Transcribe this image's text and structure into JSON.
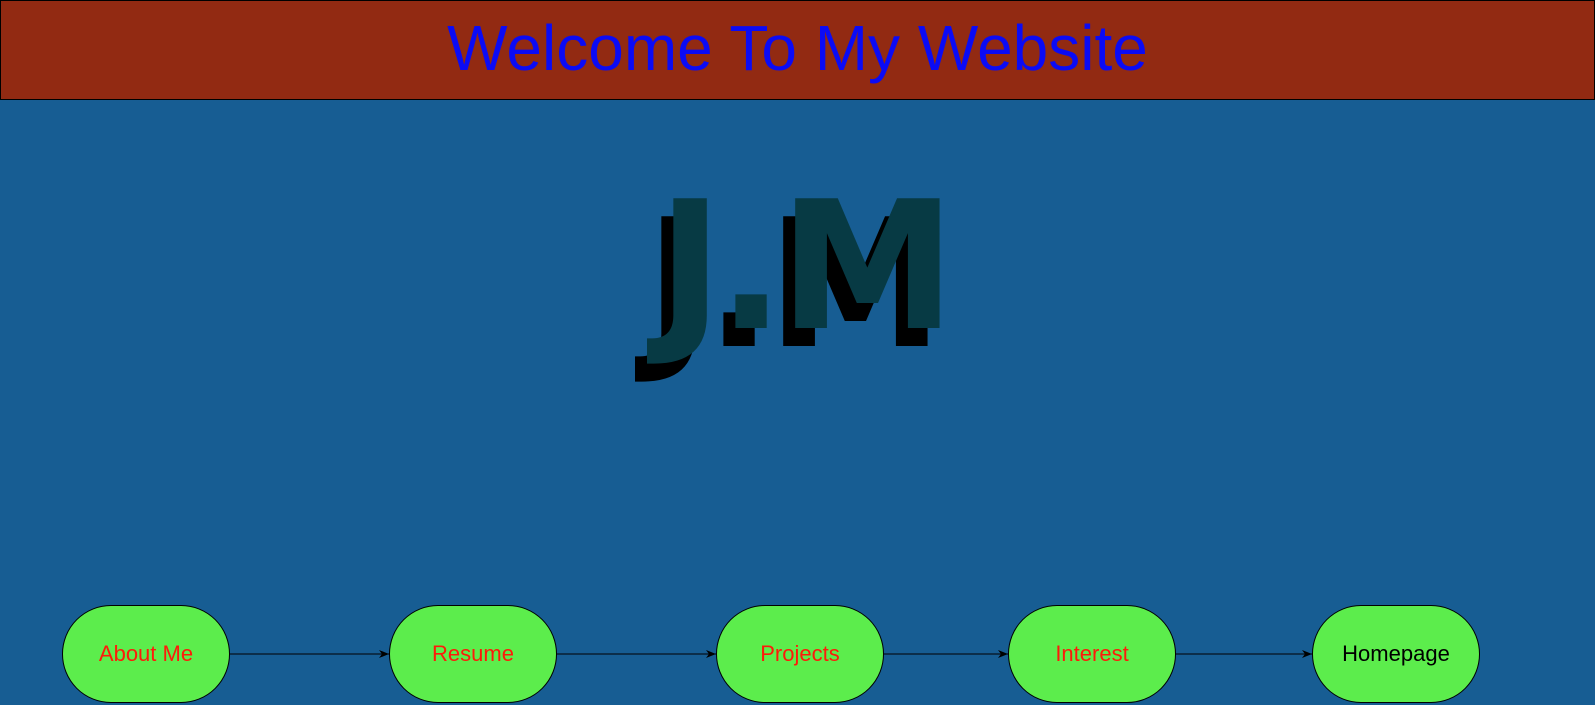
{
  "header": {
    "title": "Welcome To My Website",
    "background": "#922a12",
    "title_color": "#0b0bf5"
  },
  "monogram": {
    "text": "J.M",
    "front_color": "#073a44",
    "shadow_color": "#000000"
  },
  "page_background": "#175d93",
  "flow": {
    "node_fill": "#5ced4c",
    "nodes": [
      {
        "label": "About Me",
        "color": "#ff1a0a"
      },
      {
        "label": "Resume",
        "color": "#ff1a0a"
      },
      {
        "label": "Projects",
        "color": "#ff1a0a"
      },
      {
        "label": "Interest",
        "color": "#ff1a0a"
      },
      {
        "label": "Homepage",
        "color": "#000000"
      }
    ]
  }
}
